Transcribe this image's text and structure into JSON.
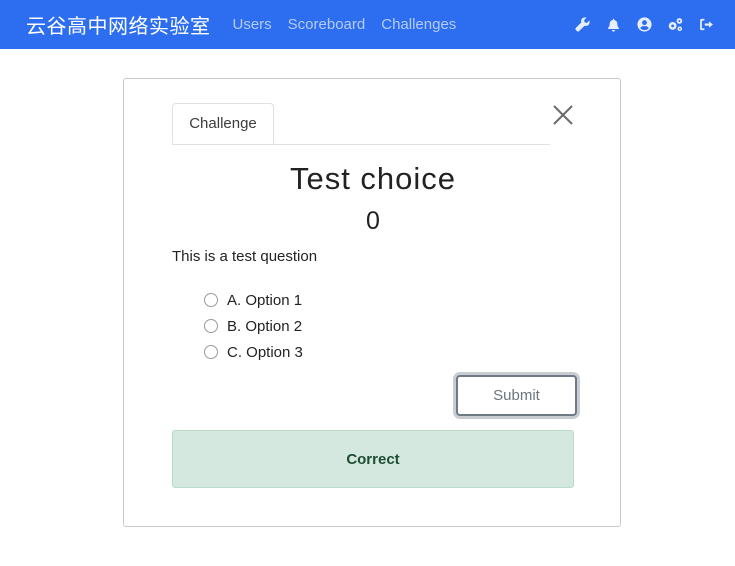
{
  "navbar": {
    "brand": "云谷高中网络实验室",
    "links": [
      "Users",
      "Scoreboard",
      "Challenges"
    ],
    "icons": [
      "wrench-icon",
      "bell-icon",
      "user-circle-icon",
      "cogs-icon",
      "sign-out-icon"
    ],
    "background": "#2d6ef0"
  },
  "modal": {
    "tab_label": "Challenge",
    "title": "Test choice",
    "points": "0",
    "question": "This is a test question",
    "options": [
      "A. Option 1",
      "B. Option 2",
      "C. Option 3"
    ],
    "submit_label": "Submit",
    "result_message": "Correct",
    "result_color": "#d4e8df"
  }
}
